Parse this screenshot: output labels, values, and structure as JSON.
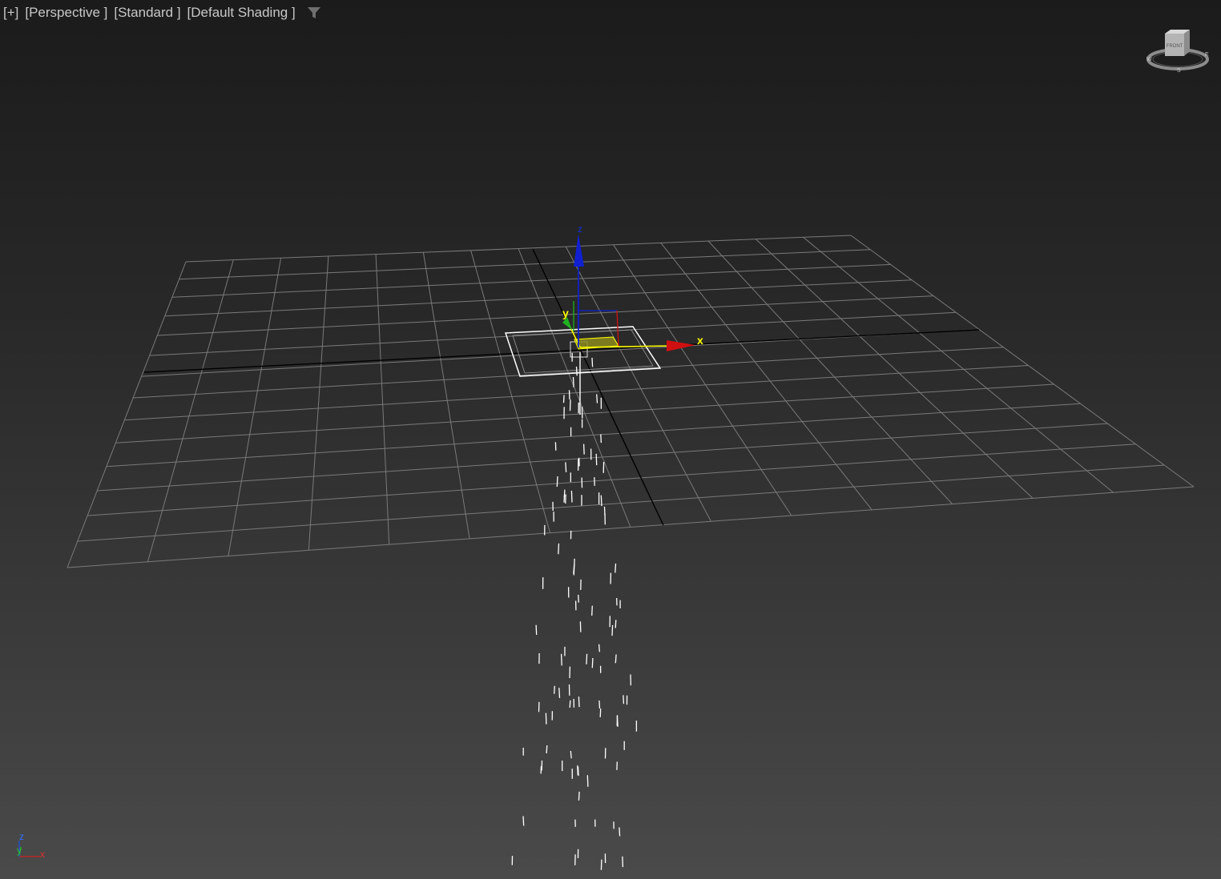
{
  "viewport": {
    "labels": {
      "menu": "[+]",
      "view": "[Perspective ]",
      "mode": "[Standard ]",
      "shading": "[Default Shading ]"
    },
    "filter_icon": "filter-funnel-icon"
  },
  "gizmo": {
    "x_label": "x",
    "y_label": "y",
    "z_label": "z",
    "colors": {
      "x": "#d01010",
      "y": "#20b020",
      "z": "#1020d0",
      "highlight": "#ffff00"
    }
  },
  "viewcube": {
    "face_label": "FRONT",
    "compass": {
      "west": "W",
      "east": "E",
      "south": "S"
    }
  },
  "world_axis": {
    "x_label": "x",
    "y_label": "y",
    "z_label": "z"
  },
  "colors": {
    "grid": "#7a7a7a",
    "grid_axis": "#000000",
    "emitter": "#ffffff",
    "particles": "#ffffff"
  }
}
